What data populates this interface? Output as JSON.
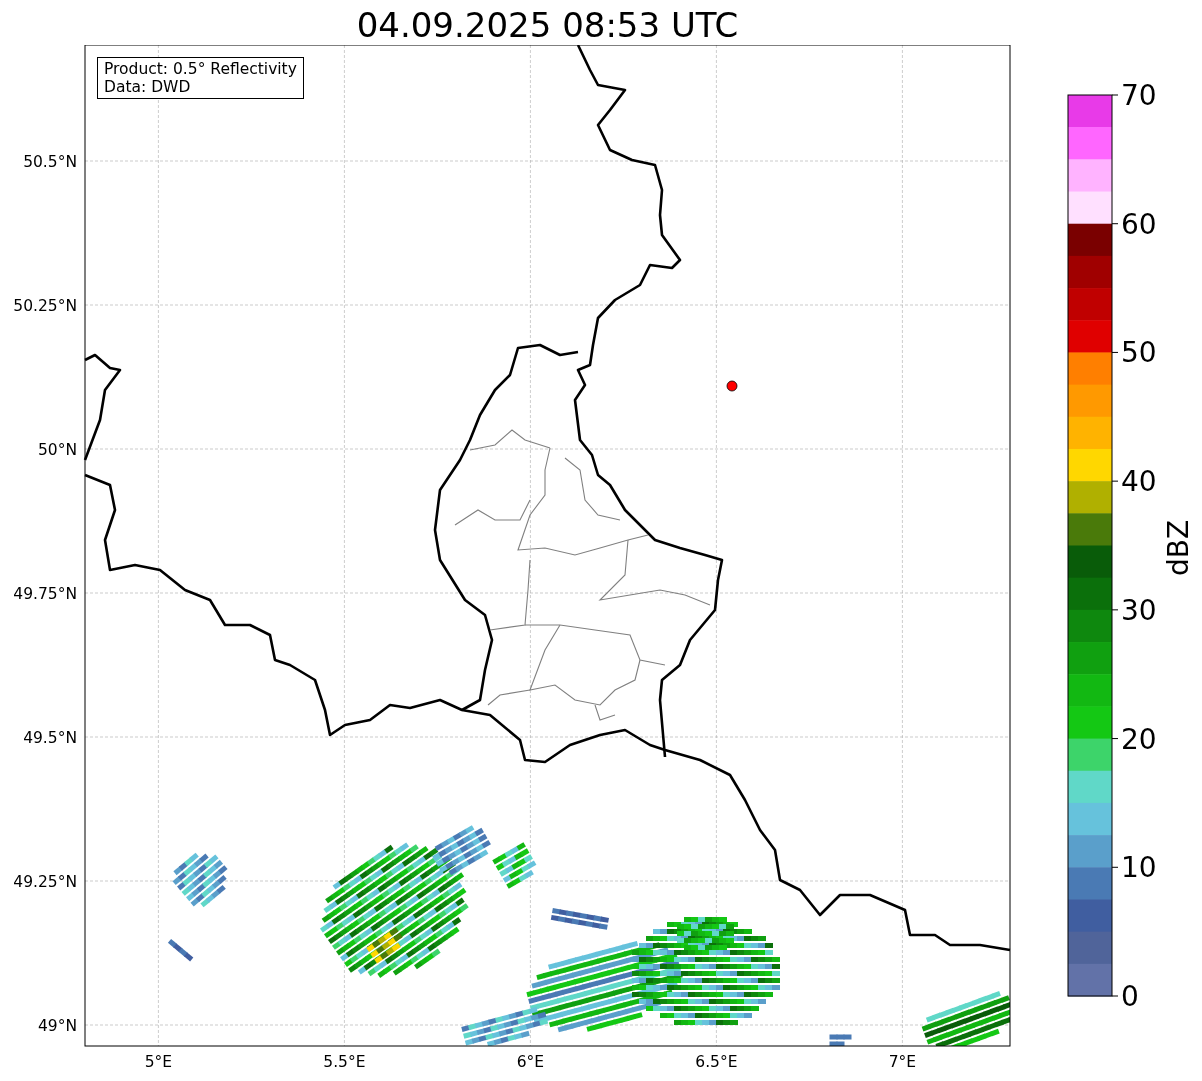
{
  "title": "04.09.2025 08:53 UTC",
  "info_box": {
    "lines": [
      "Product: 0.5° Reflectivity",
      "Data: DWD"
    ]
  },
  "map": {
    "lat_labels": [
      "50.5°N",
      "50.25°N",
      "50°N",
      "49.75°N",
      "49.5°N",
      "49.25°N",
      "49°N"
    ],
    "lon_labels": [
      "5°E",
      "5.5°E",
      "6°E",
      "6.5°E",
      "7°E"
    ]
  },
  "colorbar": {
    "label": "dBZ",
    "ticks": [
      "70",
      "60",
      "50",
      "40",
      "30",
      "20",
      "10",
      "0"
    ],
    "bands": [
      {
        "color": "#e83ae8"
      },
      {
        "color": "#ff66ff"
      },
      {
        "color": "#ffb3ff"
      },
      {
        "color": "#ffe0ff"
      },
      {
        "color": "#7a0000"
      },
      {
        "color": "#a00000"
      },
      {
        "color": "#c00000"
      },
      {
        "color": "#e00000"
      },
      {
        "color": "#ff7f00"
      },
      {
        "color": "#ff9900"
      },
      {
        "color": "#ffb300"
      },
      {
        "color": "#ffd700"
      },
      {
        "color": "#b0b000"
      },
      {
        "color": "#4a7a0a"
      },
      {
        "color": "#095c09"
      },
      {
        "color": "#0b700b"
      },
      {
        "color": "#0e880e"
      },
      {
        "color": "#10a010"
      },
      {
        "color": "#12b812"
      },
      {
        "color": "#14c814"
      },
      {
        "color": "#3dd46a"
      },
      {
        "color": "#60d8c8"
      },
      {
        "color": "#66c2dc"
      },
      {
        "color": "#5a9fcb"
      },
      {
        "color": "#4a7ab4"
      },
      {
        "color": "#405ea0"
      },
      {
        "color": "#50649a"
      },
      {
        "color": "#6272a8"
      }
    ]
  }
}
